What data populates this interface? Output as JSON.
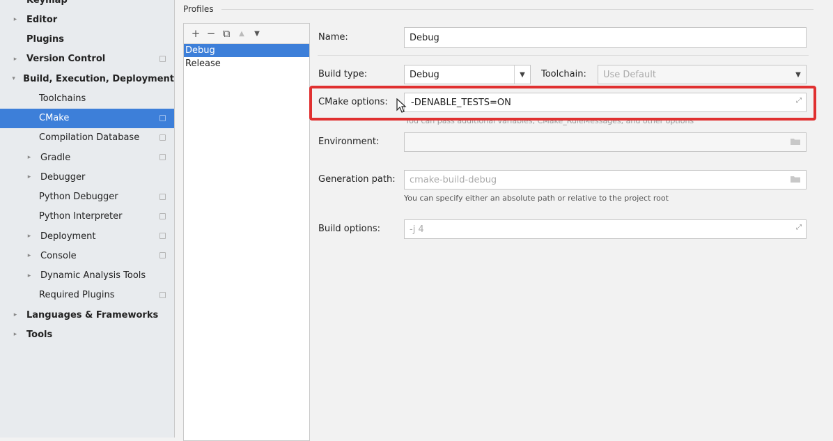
{
  "sidebar": {
    "items": [
      {
        "label": "Keymap",
        "level": 0,
        "bold": true,
        "arrow": "",
        "project": false
      },
      {
        "label": "Editor",
        "level": 0,
        "bold": true,
        "arrow": "▸",
        "project": false
      },
      {
        "label": "Plugins",
        "level": 0,
        "bold": true,
        "arrow": "",
        "project": false
      },
      {
        "label": "Version Control",
        "level": 0,
        "bold": true,
        "arrow": "▸",
        "project": true
      },
      {
        "label": "Build, Execution, Deployment",
        "level": 0,
        "bold": true,
        "arrow": "▾",
        "project": false
      },
      {
        "label": "Toolchains",
        "level": 1,
        "bold": false,
        "arrow": "",
        "project": false
      },
      {
        "label": "CMake",
        "level": 1,
        "bold": false,
        "arrow": "",
        "project": true,
        "selected": true
      },
      {
        "label": "Compilation Database",
        "level": 1,
        "bold": false,
        "arrow": "",
        "project": true
      },
      {
        "label": "Gradle",
        "level": 1,
        "bold": false,
        "arrow": "▸",
        "project": true
      },
      {
        "label": "Debugger",
        "level": 1,
        "bold": false,
        "arrow": "▸",
        "project": false
      },
      {
        "label": "Python Debugger",
        "level": 1,
        "bold": false,
        "arrow": "",
        "project": true
      },
      {
        "label": "Python Interpreter",
        "level": 1,
        "bold": false,
        "arrow": "",
        "project": true
      },
      {
        "label": "Deployment",
        "level": 1,
        "bold": false,
        "arrow": "▸",
        "project": true
      },
      {
        "label": "Console",
        "level": 1,
        "bold": false,
        "arrow": "▸",
        "project": true
      },
      {
        "label": "Dynamic Analysis Tools",
        "level": 1,
        "bold": false,
        "arrow": "▸",
        "project": false
      },
      {
        "label": "Required Plugins",
        "level": 1,
        "bold": false,
        "arrow": "",
        "project": true
      },
      {
        "label": "Languages & Frameworks",
        "level": 0,
        "bold": true,
        "arrow": "▸",
        "project": false
      },
      {
        "label": "Tools",
        "level": 0,
        "bold": true,
        "arrow": "▸",
        "project": false
      }
    ]
  },
  "profiles": {
    "title": "Profiles",
    "toolbar": {
      "add": "+",
      "remove": "−",
      "copy": "⧉",
      "up": "▲",
      "down": "▼"
    },
    "items": [
      {
        "label": "Debug",
        "selected": true
      },
      {
        "label": "Release",
        "selected": false
      }
    ]
  },
  "form": {
    "name_label": "Name:",
    "name_value": "Debug",
    "build_type_label": "Build type:",
    "build_type_value": "Debug",
    "toolchain_label": "Toolchain:",
    "toolchain_value": "Use Default",
    "cmake_options_label": "CMake options:",
    "cmake_options_value": "-DENABLE_TESTS=ON",
    "cmake_options_hint": "You can pass additional variables, CMake_RuleMessages, and other options",
    "environment_label": "Environment:",
    "environment_value": "",
    "generation_path_label": "Generation path:",
    "generation_path_value": "cmake-build-debug",
    "generation_path_hint": "You can specify either an absolute path or relative to the project root",
    "build_options_label": "Build options:",
    "build_options_value": "-j 4"
  },
  "colors": {
    "accent": "#3d7fd9",
    "highlight": "#e03030"
  },
  "icons": [
    "folder-icon",
    "expand-icon",
    "combo-arrow-icon",
    "cursor-icon"
  ]
}
